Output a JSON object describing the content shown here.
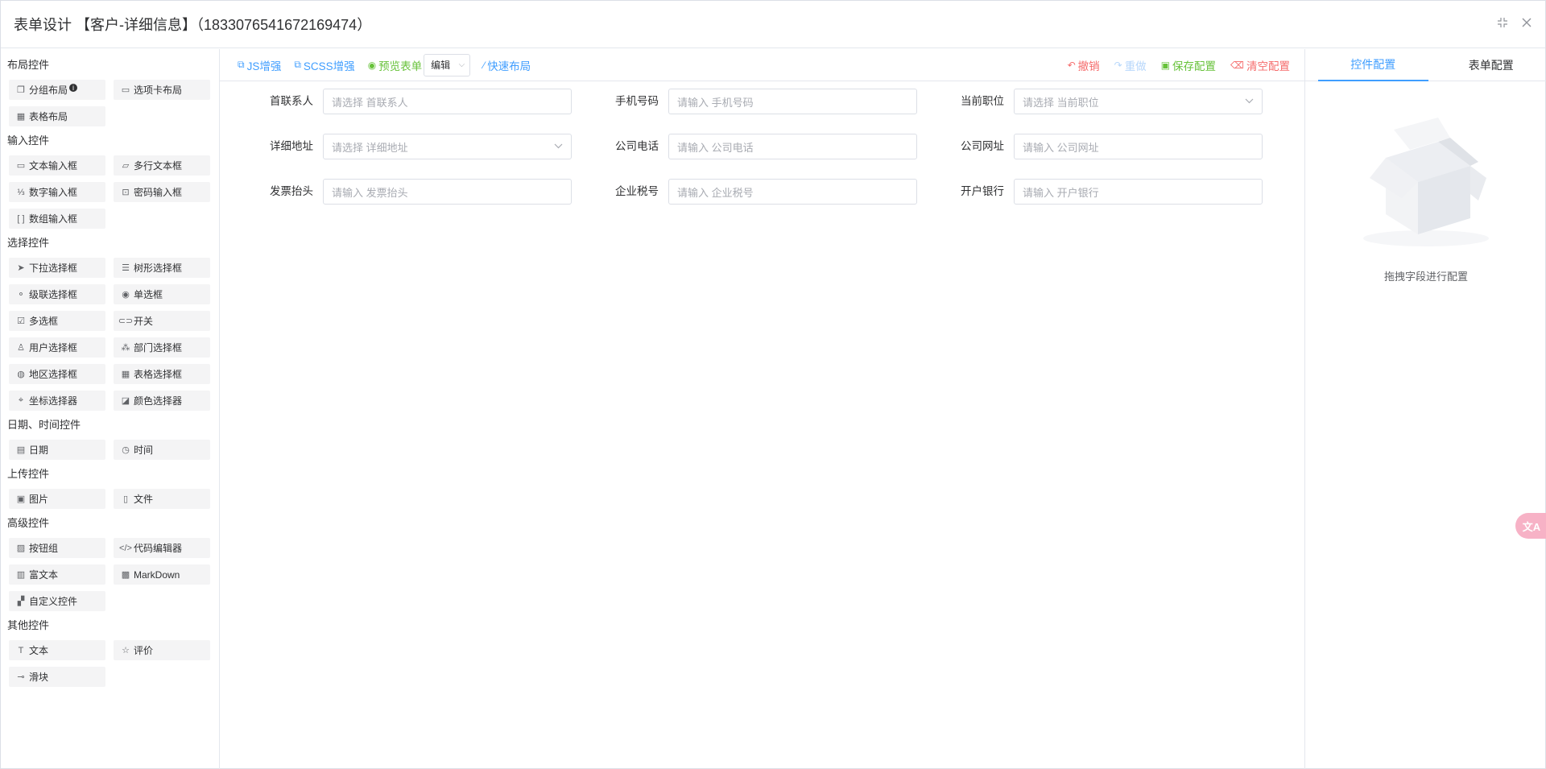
{
  "window": {
    "title": "表单设计 【客户-详细信息】（1833076541672169474）"
  },
  "left_panel": {
    "groups": [
      {
        "title": "布局控件",
        "items": [
          {
            "label": "分组布局",
            "icon": "group-layout-icon",
            "glyph": "❐",
            "info": "i"
          },
          {
            "label": "选项卡布局",
            "icon": "tabs-layout-icon",
            "glyph": "▭"
          },
          {
            "label": "表格布局",
            "icon": "table-layout-icon",
            "glyph": "▦"
          }
        ]
      },
      {
        "title": "输入控件",
        "items": [
          {
            "label": "文本输入框",
            "icon": "text-input-icon",
            "glyph": "▭"
          },
          {
            "label": "多行文本框",
            "icon": "textarea-icon",
            "glyph": "▱"
          },
          {
            "label": "数字输入框",
            "icon": "number-input-icon",
            "glyph": "⅓"
          },
          {
            "label": "密码输入框",
            "icon": "password-input-icon",
            "glyph": "⊡"
          },
          {
            "label": "数组输入框",
            "icon": "array-input-icon",
            "glyph": "[ ]"
          }
        ]
      },
      {
        "title": "选择控件",
        "items": [
          {
            "label": "下拉选择框",
            "icon": "cursor-icon",
            "glyph": "➤"
          },
          {
            "label": "树形选择框",
            "icon": "tree-select-icon",
            "glyph": "☰"
          },
          {
            "label": "级联选择框",
            "icon": "cascader-icon",
            "glyph": "⚬"
          },
          {
            "label": "单选框",
            "icon": "radio-icon",
            "glyph": "◉"
          },
          {
            "label": "多选框",
            "icon": "checkbox-icon",
            "glyph": "☑"
          },
          {
            "label": "开关",
            "icon": "switch-icon",
            "glyph": "⊂⊃"
          },
          {
            "label": "用户选择框",
            "icon": "user-icon",
            "glyph": "♙"
          },
          {
            "label": "部门选择框",
            "icon": "department-icon",
            "glyph": "⁂"
          },
          {
            "label": "地区选择框",
            "icon": "region-icon",
            "glyph": "◍"
          },
          {
            "label": "表格选择框",
            "icon": "table-select-icon",
            "glyph": "▦"
          },
          {
            "label": "坐标选择器",
            "icon": "coordinate-icon",
            "glyph": "⌖"
          },
          {
            "label": "颜色选择器",
            "icon": "color-picker-icon",
            "glyph": "◪"
          }
        ]
      },
      {
        "title": "日期、时间控件",
        "items": [
          {
            "label": "日期",
            "icon": "calendar-icon",
            "glyph": "▤"
          },
          {
            "label": "时间",
            "icon": "clock-icon",
            "glyph": "◷"
          }
        ]
      },
      {
        "title": "上传控件",
        "items": [
          {
            "label": "图片",
            "icon": "image-icon",
            "glyph": "▣"
          },
          {
            "label": "文件",
            "icon": "file-icon",
            "glyph": "▯"
          }
        ]
      },
      {
        "title": "高级控件",
        "items": [
          {
            "label": "按钮组",
            "icon": "button-group-icon",
            "glyph": "▨"
          },
          {
            "label": "代码编辑器",
            "icon": "code-icon",
            "glyph": "</>"
          },
          {
            "label": "富文本",
            "icon": "rich-text-icon",
            "glyph": "▥"
          },
          {
            "label": "MarkDown",
            "icon": "markdown-icon",
            "glyph": "▩"
          },
          {
            "label": "自定义控件",
            "icon": "custom-widget-icon",
            "glyph": "▞"
          }
        ]
      },
      {
        "title": "其他控件",
        "items": [
          {
            "label": "文本",
            "icon": "text-icon",
            "glyph": "T"
          },
          {
            "label": "评价",
            "icon": "star-icon",
            "glyph": "☆"
          },
          {
            "label": "滑块",
            "icon": "slider-icon",
            "glyph": "⊸"
          }
        ]
      }
    ]
  },
  "toolbar": {
    "js": "JS增强",
    "scss": "SCSS增强",
    "preview": "预览表单",
    "mode_value": "编辑",
    "quick_layout": "快速布局",
    "undo": "撤销",
    "redo": "重做",
    "save": "保存配置",
    "clear": "清空配置"
  },
  "form": {
    "rows": [
      [
        {
          "label": "首联系人",
          "placeholder": "请选择 首联系人",
          "type": "input"
        },
        {
          "label": "手机号码",
          "placeholder": "请输入 手机号码",
          "type": "input"
        },
        {
          "label": "当前职位",
          "placeholder": "请选择 当前职位",
          "type": "select"
        }
      ],
      [
        {
          "label": "详细地址",
          "placeholder": "请选择 详细地址",
          "type": "select"
        },
        {
          "label": "公司电话",
          "placeholder": "请输入 公司电话",
          "type": "input"
        },
        {
          "label": "公司网址",
          "placeholder": "请输入 公司网址",
          "type": "input"
        }
      ],
      [
        {
          "label": "发票抬头",
          "placeholder": "请输入 发票抬头",
          "type": "input"
        },
        {
          "label": "企业税号",
          "placeholder": "请输入 企业税号",
          "type": "input"
        },
        {
          "label": "开户银行",
          "placeholder": "请输入 开户银行",
          "type": "input"
        }
      ]
    ]
  },
  "right_panel": {
    "tabs": [
      "控件配置",
      "表单配置"
    ],
    "active_tab": 0,
    "empty_text": "拖拽字段进行配置"
  },
  "colors": {
    "primary": "#409eff",
    "success": "#67c23a",
    "danger": "#f56c6c",
    "disabled_blue": "#b7d7fb",
    "float_badge": "#f7b2c6"
  }
}
